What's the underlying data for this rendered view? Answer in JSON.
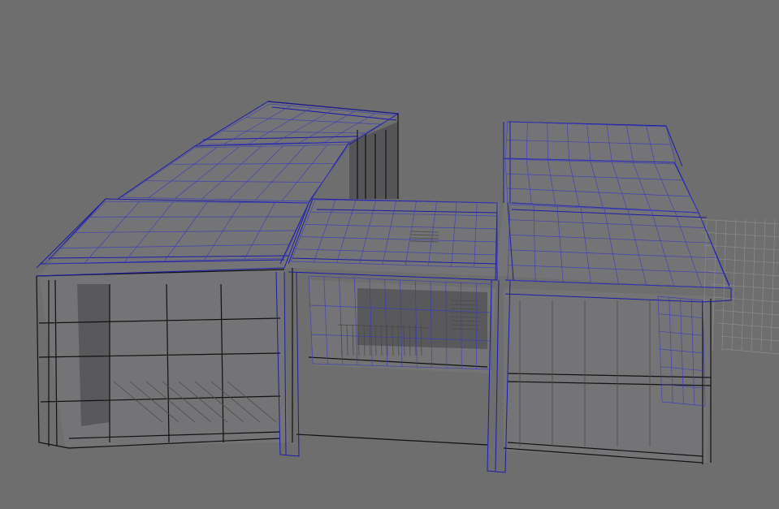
{
  "viewport": {
    "background_color": "#6e6e6e",
    "wire_selected_color": "#1c1ca8",
    "wire_unselected_color": "#111111",
    "ground_grid_color": "#8a8a8a"
  },
  "icons": {
    "wireframe_model": "building-wireframe-icon"
  }
}
